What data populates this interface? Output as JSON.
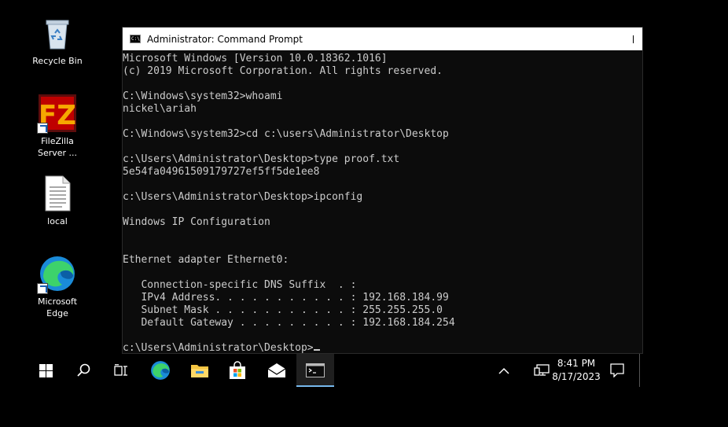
{
  "desktop": {
    "icons": [
      {
        "label": "Recycle Bin"
      },
      {
        "label": "FileZilla\nServer ..."
      },
      {
        "label": "local"
      },
      {
        "label": "Microsoft\nEdge"
      }
    ]
  },
  "window": {
    "title": "Administrator: Command Prompt",
    "icon_text": "C:\\.",
    "lines": [
      "Microsoft Windows [Version 10.0.18362.1016]",
      "(c) 2019 Microsoft Corporation. All rights reserved.",
      "",
      "C:\\Windows\\system32>whoami",
      "nickel\\ariah",
      "",
      "C:\\Windows\\system32>cd c:\\users\\Administrator\\Desktop",
      "",
      "c:\\Users\\Administrator\\Desktop>type proof.txt",
      "5e54fa04961509179727ef5ff5de1ee8",
      "",
      "c:\\Users\\Administrator\\Desktop>ipconfig",
      "",
      "Windows IP Configuration",
      "",
      "",
      "Ethernet adapter Ethernet0:",
      "",
      "   Connection-specific DNS Suffix  . :",
      "   IPv4 Address. . . . . . . . . . . : 192.168.184.99",
      "   Subnet Mask . . . . . . . . . . . : 255.255.255.0",
      "   Default Gateway . . . . . . . . . : 192.168.184.254",
      "",
      "c:\\Users\\Administrator\\Desktop>"
    ]
  },
  "taskbar": {
    "time": "8:41 PM",
    "date": "8/17/2023",
    "items": [
      "start-icon",
      "search-icon",
      "task-view-icon",
      "edge-icon",
      "file-explorer-icon",
      "store-icon",
      "mail-icon",
      "command-prompt-icon"
    ],
    "accent": "#76b9ed"
  }
}
